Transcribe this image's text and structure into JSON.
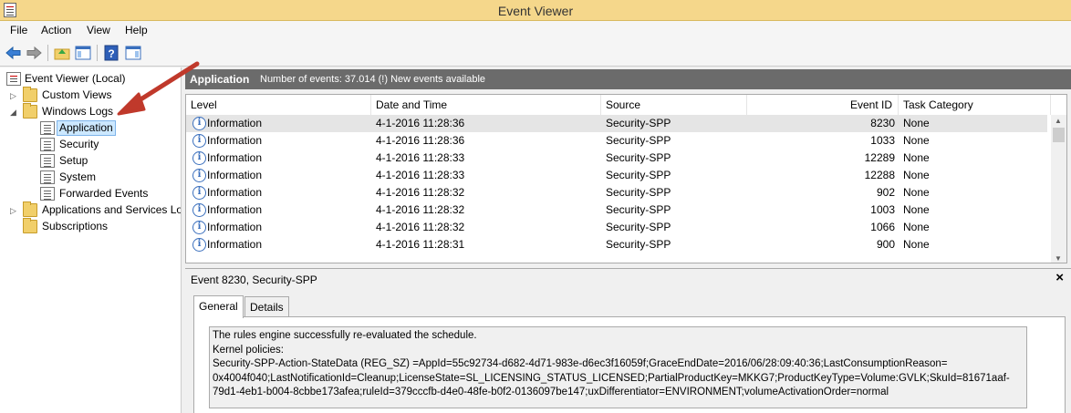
{
  "window": {
    "title": "Event Viewer"
  },
  "menu": {
    "items": [
      "File",
      "Action",
      "View",
      "Help"
    ]
  },
  "toolbar": {
    "icons": [
      "back-arrow-icon",
      "forward-arrow-icon",
      "folder-up-icon",
      "show-hide-pane-icon",
      "help-icon",
      "action-pane-icon"
    ]
  },
  "tree": {
    "root": "Event Viewer (Local)",
    "items": [
      {
        "label": "Custom Views"
      },
      {
        "label": "Windows Logs"
      },
      {
        "label": "Application"
      },
      {
        "label": "Security"
      },
      {
        "label": "Setup"
      },
      {
        "label": "System"
      },
      {
        "label": "Forwarded Events"
      },
      {
        "label": "Applications and Services Lo"
      },
      {
        "label": "Subscriptions"
      }
    ]
  },
  "list_header": {
    "log_name": "Application",
    "count_text": "Number of events: 37.014 (!) New events available"
  },
  "table": {
    "columns": [
      "Level",
      "Date and Time",
      "Source",
      "Event ID",
      "Task Category"
    ],
    "rows": [
      {
        "level": "Information",
        "datetime": "4-1-2016 11:28:36",
        "source": "Security-SPP",
        "event_id": "8230",
        "category": "None"
      },
      {
        "level": "Information",
        "datetime": "4-1-2016 11:28:36",
        "source": "Security-SPP",
        "event_id": "1033",
        "category": "None"
      },
      {
        "level": "Information",
        "datetime": "4-1-2016 11:28:33",
        "source": "Security-SPP",
        "event_id": "12289",
        "category": "None"
      },
      {
        "level": "Information",
        "datetime": "4-1-2016 11:28:33",
        "source": "Security-SPP",
        "event_id": "12288",
        "category": "None"
      },
      {
        "level": "Information",
        "datetime": "4-1-2016 11:28:32",
        "source": "Security-SPP",
        "event_id": "902",
        "category": "None"
      },
      {
        "level": "Information",
        "datetime": "4-1-2016 11:28:32",
        "source": "Security-SPP",
        "event_id": "1003",
        "category": "None"
      },
      {
        "level": "Information",
        "datetime": "4-1-2016 11:28:32",
        "source": "Security-SPP",
        "event_id": "1066",
        "category": "None"
      },
      {
        "level": "Information",
        "datetime": "4-1-2016 11:28:31",
        "source": "Security-SPP",
        "event_id": "900",
        "category": "None"
      }
    ]
  },
  "detail": {
    "title": "Event 8230, Security-SPP",
    "close": "×",
    "tabs": [
      "General",
      "Details"
    ],
    "message": [
      "The rules engine successfully re-evaluated the schedule.",
      "Kernel policies:",
      "Security-SPP-Action-StateData (REG_SZ) =AppId=55c92734-d682-4d71-983e-d6ec3f16059f;GraceEndDate=2016/06/28:09:40:36;LastConsumptionReason=",
      "0x4004f040;LastNotificationId=Cleanup;LicenseState=SL_LICENSING_STATUS_LICENSED;PartialProductKey=MKKG7;ProductKeyType=Volume:GVLK;SkuId=81671aaf-",
      "79d1-4eb1-b004-8cbbe173afea;ruleId=379cccfb-d4e0-48fe-b0f2-0136097be147;uxDifferentiator=ENVIRONMENT;volumeActivationOrder=normal"
    ]
  },
  "colors": {
    "titlebar": "#f5d78b",
    "header_strip": "#6b6b6b",
    "selection": "#cce8ff",
    "arrow": "#c0392b"
  }
}
